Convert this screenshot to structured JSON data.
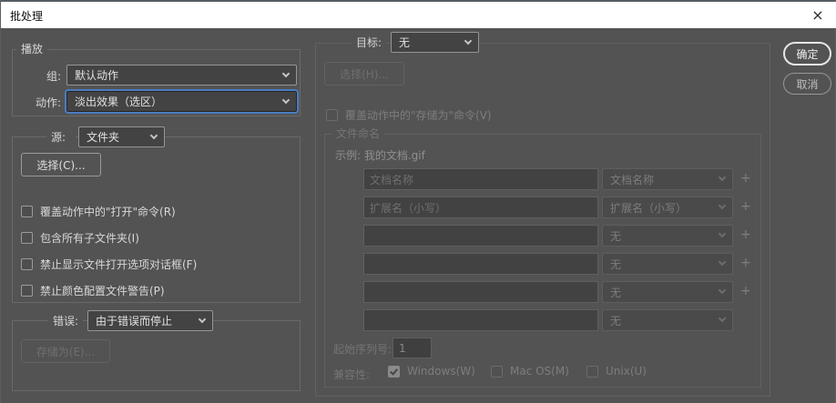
{
  "window": {
    "title": "批处理",
    "close_glyph": "×"
  },
  "actions": {
    "ok": "确定",
    "cancel": "取消"
  },
  "play": {
    "legend": "播放",
    "set_label": "组:",
    "set_value": "默认动作",
    "action_label": "动作:",
    "action_value": "淡出效果（选区）"
  },
  "source": {
    "label": "源:",
    "value": "文件夹",
    "choose_button": "选择(C)...",
    "checkboxes": [
      "覆盖动作中的\"打开\"命令(R)",
      "包含所有子文件夹(I)",
      "禁止显示文件打开选项对话框(F)",
      "禁止颜色配置文件警告(P)"
    ]
  },
  "errors": {
    "label": "错误:",
    "value": "由于错误而停止",
    "save_as_button": "存储为(E)..."
  },
  "destination": {
    "label": "目标:",
    "value": "无",
    "choose_button": "选择(H)...",
    "override_checkbox": "覆盖动作中的\"存储为\"命令(V)"
  },
  "file_naming": {
    "legend": "文件命名",
    "example": "示例: 我的文档.gif",
    "plus_glyph": "+",
    "rows": [
      {
        "input": "文档名称",
        "select": "文档名称",
        "has_plus": true
      },
      {
        "input": "扩展名（小写）",
        "select": "扩展名（小写）",
        "has_plus": true
      },
      {
        "input": "",
        "select": "无",
        "has_plus": true
      },
      {
        "input": "",
        "select": "无",
        "has_plus": true
      },
      {
        "input": "",
        "select": "无",
        "has_plus": true
      },
      {
        "input": "",
        "select": "无",
        "has_plus": false
      }
    ],
    "serial_label": "起始序列号:",
    "serial_value": "1",
    "compat_label": "兼容性:",
    "compat": [
      {
        "label": "Windows(W)",
        "checked": true
      },
      {
        "label": "Mac OS(M)",
        "checked": false
      },
      {
        "label": "Unix(U)",
        "checked": false
      }
    ]
  },
  "colors": {
    "dialog_bg": "#535353",
    "titlebar_bg": "#ffffff",
    "focus_ring": "#4a7dc2",
    "group_border": "#696969"
  }
}
